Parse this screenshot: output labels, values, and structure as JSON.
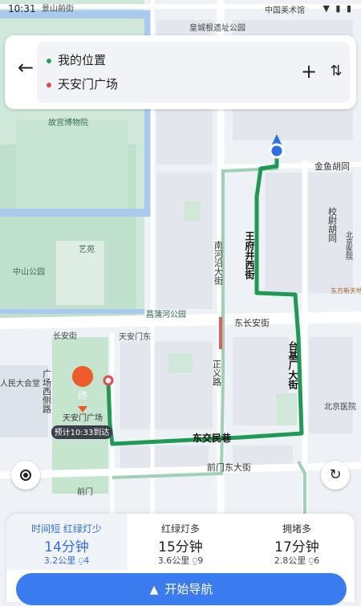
{
  "status": {
    "time": "10:31",
    "icons": "▼ ▮ ▮"
  },
  "route": {
    "origin": "我的位置",
    "destination": "天安门广场",
    "origin_dot_color": "#22a45b",
    "destination_dot_color": "#e5484d"
  },
  "map": {
    "labels": {
      "jingshan_street": "景山前街",
      "meishuguan": "中国美术馆",
      "huangcheng_park": "皇城根遗址公园",
      "palace_museum": "故宫博物院",
      "jinyu_hutong": "金鱼胡同",
      "xiaowei_hutong": "校尉胡同",
      "beijing_hospital_area": "北京医院",
      "wangfujing_west": "王府井西街",
      "nanheyan": "南河沿大街",
      "yiyuan": "艺苑",
      "zhongshan_park": "中山公园",
      "changpu_park": "菖蒲河公园",
      "dongchangan": "东长安街",
      "taijichang": "台基厂大街",
      "changan_street": "长安街",
      "tiananmen_east": "天安门东",
      "renmin_dahuitang": "人民大会堂",
      "square_west": "广场西侧路",
      "tiananmen_square": "天安门广场",
      "arrival": "预计10:33到达",
      "zhengyi": "正义路",
      "dongjiaominxiang": "东交民巷",
      "qianmen_east": "前门东大街",
      "qianmen": "前门",
      "beijing_hospital": "北京医院",
      "dongfang_xintiandi": "东方新天地",
      "end_marker": "终"
    },
    "route_color": "#1f9a55"
  },
  "routes": [
    {
      "tag": "时间短 红绿灯少",
      "duration": "14分钟",
      "meta": "3.2公里 ⍜4"
    },
    {
      "tag": "红绿灯多",
      "duration": "15分钟",
      "meta": "3.6公里 ⍜9"
    },
    {
      "tag": "拥堵多",
      "duration": "17分钟",
      "meta": "2.8公里 ⍜6"
    }
  ],
  "nav_button": {
    "label": "开始导航"
  }
}
